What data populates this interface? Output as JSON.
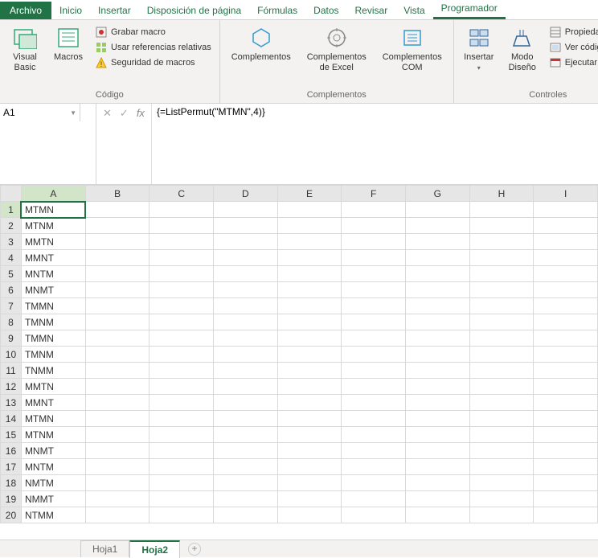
{
  "tabs": {
    "file": "Archivo",
    "home": "Inicio",
    "insert": "Insertar",
    "layout": "Disposición de página",
    "formulas": "Fórmulas",
    "data": "Datos",
    "review": "Revisar",
    "view": "Vista",
    "developer": "Programador"
  },
  "ribbon": {
    "code": {
      "visual_basic": "Visual Basic",
      "macros": "Macros",
      "record_macro": "Grabar macro",
      "relative_refs": "Usar referencias relativas",
      "macro_security": "Seguridad de macros",
      "label": "Código"
    },
    "addins": {
      "addins": "Complementos",
      "excel_addins": "Complementos de Excel",
      "com_addins": "Complementos COM",
      "label": "Complementos"
    },
    "controls": {
      "insert": "Insertar",
      "design_mode": "Modo Diseño",
      "properties": "Propiedades",
      "view_code": "Ver código",
      "run_dialog": "Ejecutar cuadro d",
      "label": "Controles"
    }
  },
  "namebox": {
    "value": "A1"
  },
  "formula": {
    "value": "{=ListPermut(\"MTMN\",4)}"
  },
  "columns": [
    "A",
    "B",
    "C",
    "D",
    "E",
    "F",
    "G",
    "H",
    "I"
  ],
  "rows": [
    {
      "n": 1,
      "a": "MTMN"
    },
    {
      "n": 2,
      "a": "MTNM"
    },
    {
      "n": 3,
      "a": "MMTN"
    },
    {
      "n": 4,
      "a": "MMNT"
    },
    {
      "n": 5,
      "a": "MNTM"
    },
    {
      "n": 6,
      "a": "MNMT"
    },
    {
      "n": 7,
      "a": "TMMN"
    },
    {
      "n": 8,
      "a": "TMNM"
    },
    {
      "n": 9,
      "a": "TMMN"
    },
    {
      "n": 10,
      "a": "TMNM"
    },
    {
      "n": 11,
      "a": "TNMM"
    },
    {
      "n": 12,
      "a": "MMTN"
    },
    {
      "n": 13,
      "a": "MMNT"
    },
    {
      "n": 14,
      "a": "MTMN"
    },
    {
      "n": 15,
      "a": "MTNM"
    },
    {
      "n": 16,
      "a": "MNMT"
    },
    {
      "n": 17,
      "a": "MNTM"
    },
    {
      "n": 18,
      "a": "NMTM"
    },
    {
      "n": 19,
      "a": "NMMT"
    },
    {
      "n": 20,
      "a": "NTMM"
    }
  ],
  "sheets": {
    "s1": "Hoja1",
    "s2": "Hoja2"
  }
}
